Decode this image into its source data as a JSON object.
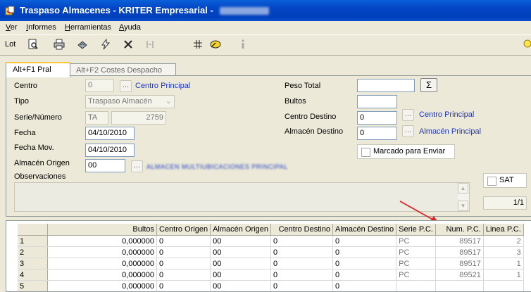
{
  "window": {
    "title": "Traspaso Almacenes - KRITER Empresarial - "
  },
  "menu": [
    "Ver",
    "Informes",
    "Herramientas",
    "Ayuda"
  ],
  "toolbar": {
    "lot_label": "Lot"
  },
  "tabs": [
    {
      "label": "Alt+F1 Pral",
      "active": true
    },
    {
      "label": "Alt+F2 Costes Despacho",
      "active": false
    }
  ],
  "form": {
    "centro_label": "Centro",
    "centro_value": "0",
    "centro_link": "Centro Principal",
    "tipo_label": "Tipo",
    "tipo_value": "Traspaso Almacén",
    "serie_label": "Serie/Número",
    "serie_value": "TA",
    "numero_value": "2759",
    "fecha_label": "Fecha",
    "fecha_value": "04/10/2010",
    "fecha_mov_label": "Fecha Mov.",
    "fecha_mov_value": "04/10/2010",
    "almacen_origen_label": "Almacén Origen",
    "almacen_origen_value": "00",
    "almacen_origen_link": "ALMACEN MULTIUBICACIONES PRINCIPAL",
    "observaciones_label": "Observaciones",
    "peso_total_label": "Peso Total",
    "peso_total_value": "",
    "bultos_label": "Bultos",
    "bultos_value": "",
    "centro_destino_label": "Centro Destino",
    "centro_destino_value": "0",
    "centro_destino_link": "Centro Principal",
    "almacen_destino_label": "Almacén Destino",
    "almacen_destino_value": "0",
    "almacen_destino_link": "Almacén Principal",
    "marcado_label": "Marcado para Enviar",
    "sat_label": "SAT",
    "page_indicator": "1/1",
    "sigma_label": "Σ"
  },
  "grid": {
    "columns": [
      "Bultos",
      "Centro Origen",
      "Almacén Origen",
      "Centro Destino",
      "Almacén Destino",
      "Serie P.C.",
      "Num. P.C.",
      "Linea P.C."
    ],
    "rows": [
      {
        "idx": "1",
        "bultos": "0,000000",
        "centro_origen": "0",
        "almacen_origen": "00",
        "centro_destino": "0",
        "almacen_destino": "0",
        "serie": "PC",
        "num": "89517",
        "linea": "2"
      },
      {
        "idx": "2",
        "bultos": "0,000000",
        "centro_origen": "0",
        "almacen_origen": "00",
        "centro_destino": "0",
        "almacen_destino": "0",
        "serie": "PC",
        "num": "89517",
        "linea": "3"
      },
      {
        "idx": "3",
        "bultos": "0,000000",
        "centro_origen": "0",
        "almacen_origen": "00",
        "centro_destino": "0",
        "almacen_destino": "0",
        "serie": "PC",
        "num": "89517",
        "linea": "1"
      },
      {
        "idx": "4",
        "bultos": "0,000000",
        "centro_origen": "0",
        "almacen_origen": "00",
        "centro_destino": "0",
        "almacen_destino": "0",
        "serie": "PC",
        "num": "89521",
        "linea": "1"
      },
      {
        "idx": "5",
        "bultos": "0,000000",
        "centro_origen": "0",
        "almacen_origen": "00",
        "centro_destino": "0",
        "almacen_destino": "0",
        "serie": "",
        "num": "",
        "linea": ""
      }
    ]
  },
  "colors": {
    "link": "#1a37c7",
    "title_bar": "#0345c4",
    "annotation_arrow": "#e02020"
  }
}
